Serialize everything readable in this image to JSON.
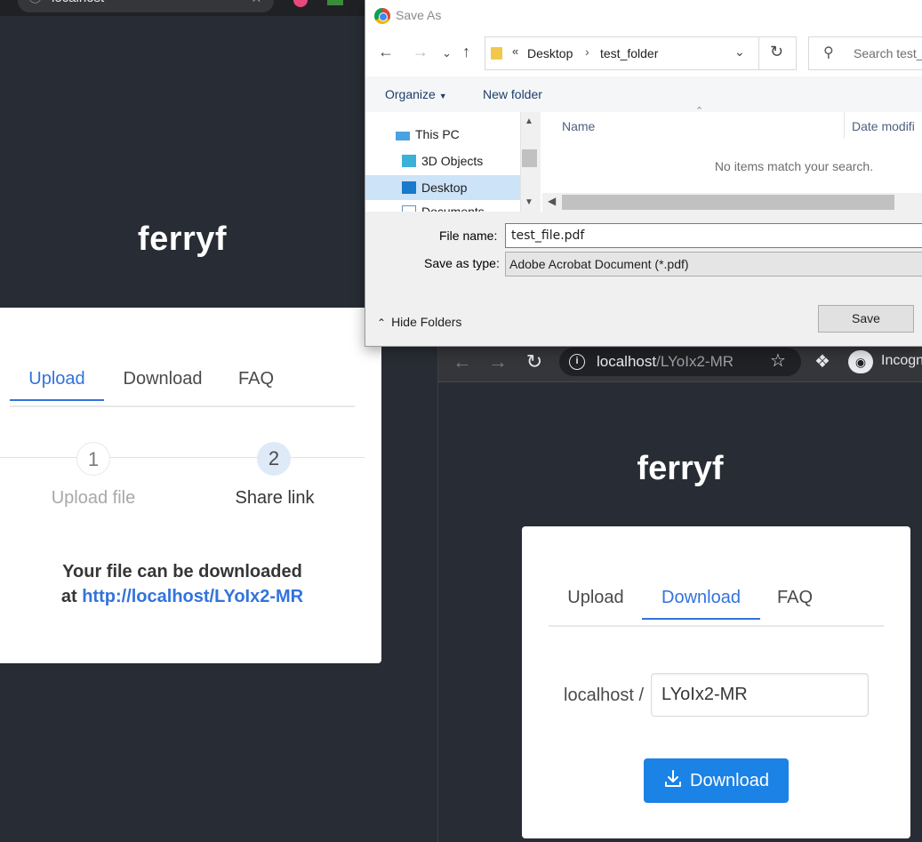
{
  "left_browser": {
    "omnibox_text": "localhost",
    "logo": "ferryf",
    "tabs": [
      {
        "label": "Upload",
        "active": true
      },
      {
        "label": "Download",
        "active": false
      },
      {
        "label": "FAQ",
        "active": false
      }
    ],
    "steps": [
      {
        "number": "1",
        "label": "Upload file",
        "state": "done"
      },
      {
        "number": "2",
        "label": "Share link",
        "state": "current"
      }
    ],
    "message_line1": "Your file can be downloaded",
    "message_prefix": "at",
    "share_url": "http://localhost/LYoIx2-MR"
  },
  "right_browser": {
    "omnibox_host": "localhost",
    "omnibox_path": "/LYoIx2-MR",
    "incognito_label": "Incogn",
    "logo": "ferryf",
    "tabs": [
      {
        "label": "Upload",
        "active": false
      },
      {
        "label": "Download",
        "active": true
      },
      {
        "label": "FAQ",
        "active": false
      }
    ],
    "download_prefix": "localhost /",
    "download_code": "LYoIx2-MR",
    "download_button": "Download"
  },
  "dialog": {
    "title": "Save As",
    "breadcrumb": [
      "Desktop",
      "test_folder"
    ],
    "breadcrumb_overflow": "«",
    "search_placeholder": "Search test_",
    "organize": "Organize",
    "new_folder": "New folder",
    "nav_items": [
      {
        "label": "This PC",
        "icon": "pc-icon"
      },
      {
        "label": "3D Objects",
        "icon": "cube-icon"
      },
      {
        "label": "Desktop",
        "icon": "desktop-icon",
        "selected": true
      },
      {
        "label": "Documents",
        "icon": "document-icon"
      }
    ],
    "columns": [
      "Name",
      "Date modifi"
    ],
    "empty_message": "No items match your search.",
    "file_name_label": "File name:",
    "file_name": "test_file.pdf",
    "save_type_label": "Save as type:",
    "save_type": "Adobe Acrobat Document (*.pdf)",
    "hide_folders": "Hide Folders",
    "save_button": "Save"
  },
  "colors": {
    "page_bg": "#282c34",
    "accent": "#3273dc",
    "button": "#1b82e6"
  }
}
